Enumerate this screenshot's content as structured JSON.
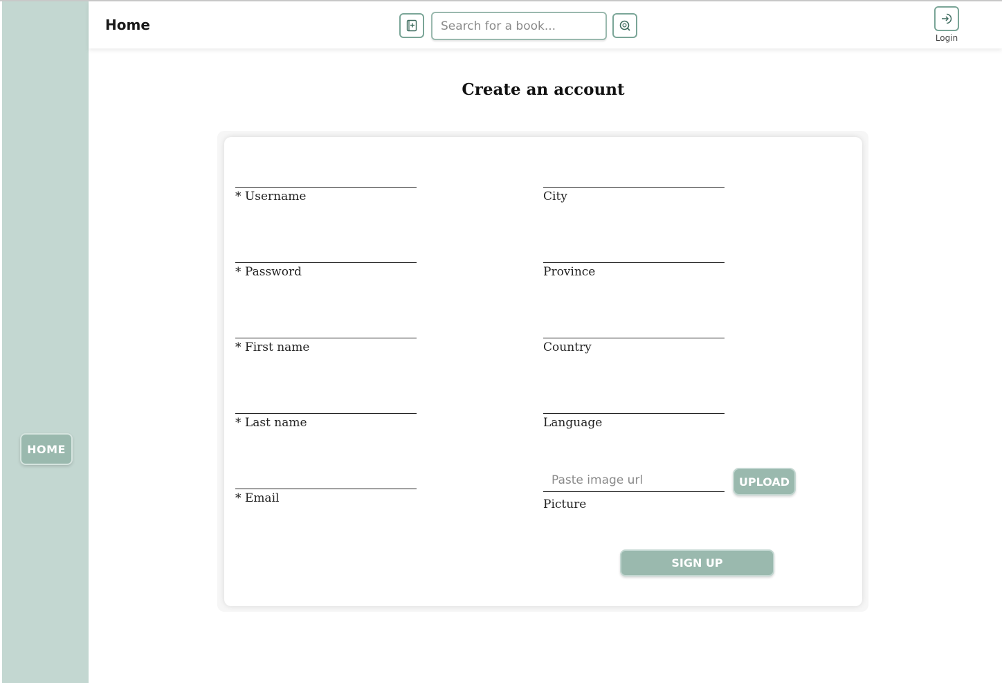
{
  "sidebar": {
    "home_label": "HOME"
  },
  "header": {
    "title": "Home",
    "search_placeholder": "Search for a book...",
    "login_label": "Login",
    "icons": {
      "add_book": "add-book-icon",
      "search": "search-icon",
      "login": "login-icon"
    }
  },
  "page": {
    "title": "Create an account"
  },
  "form": {
    "left_fields": [
      {
        "label": "* Username",
        "value": ""
      },
      {
        "label": "* Password",
        "value": ""
      },
      {
        "label": "* First name",
        "value": ""
      },
      {
        "label": "* Last name",
        "value": ""
      },
      {
        "label": "* Email",
        "value": ""
      }
    ],
    "right_fields": [
      {
        "label": "City",
        "value": ""
      },
      {
        "label": "Province",
        "value": ""
      },
      {
        "label": "Country",
        "value": ""
      },
      {
        "label": "Language",
        "value": ""
      }
    ],
    "picture": {
      "label": "Picture",
      "placeholder": "Paste image url",
      "value": ""
    },
    "upload_label": "UPLOAD",
    "signup_label": "SIGN UP"
  },
  "colors": {
    "accent": "#9ab9ae",
    "sidebar": "#c3d7d1",
    "border": "#7aa597"
  }
}
